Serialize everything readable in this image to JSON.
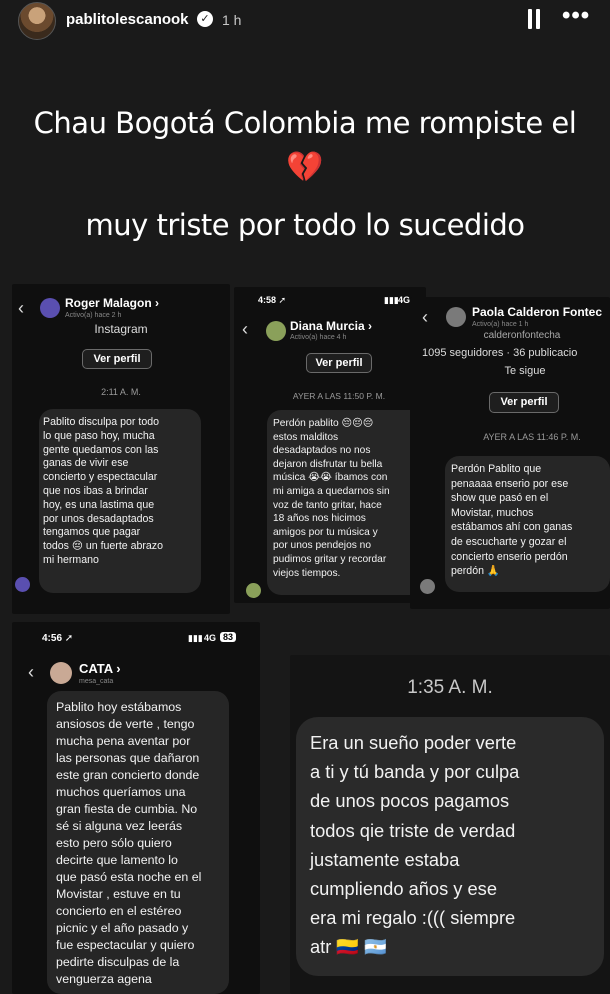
{
  "story": {
    "username": "pablitolescanook",
    "time": "1 h",
    "caption_line1": "Chau Bogotá Colombia me rompiste el",
    "caption_emoji": "💔",
    "caption_line2": "muy triste por todo lo sucedido"
  },
  "shots": {
    "roger": {
      "name": "Roger Malagon ›",
      "active": "Activo(a) hace 2 h",
      "platform": "Instagram",
      "profile_button": "Ver perfil",
      "timestamp": "2:11 A. M.",
      "message": "Pablito disculpa por todo\nlo que paso hoy, mucha\ngente quedamos con las\nganas de vivir ese\nconcierto y espectacular\nque nos ibas a brindar\nhoy, es una lastima que\npor unos desadaptados\ntengamos que pagar\ntodos 😔 un fuerte abrazo\nmi hermano"
    },
    "diana": {
      "clock": "4:58 ➚",
      "network": "4G",
      "name": "Diana Murcia ›",
      "active": "Activo(a) hace 4 h",
      "profile_button": "Ver perfil",
      "timestamp": "AYER A LAS 11:50 P. M.",
      "message": "Perdón pablito 😔😔😔\nestos malditos\ndesadaptados no nos\ndejaron disfrutar tu bella\nmúsica 😭😭 íbamos con\nmi amiga a quedarnos sin\nvoz de tanto gritar, hace\n18 años nos hicimos\namigos por tu música y\npor unos pendejos no\npudimos gritar y recordar\nviejos tiempos."
    },
    "paola": {
      "name": "Paola Calderon Fontec",
      "active": "Activo(a) hace 1 h",
      "handle": "calderonfontecha",
      "stats": "1095 seguidores · 36 publicacio",
      "follow_status": "Te sigue",
      "profile_button": "Ver perfil",
      "timestamp": "AYER A LAS 11:46 P. M.",
      "message": "Perdón Pablito que\npenaaaa enserio por ese\nshow que pasó en el\nMovistar, muchos\nestábamos ahí con ganas\nde escucharte y gozar el\nconcierto enserio perdón\nperdón 🙏"
    },
    "cata": {
      "clock": "4:56 ➚",
      "network": "4G",
      "battery": "83",
      "name": "CATA ›",
      "handle": "mesa_cata",
      "message": "Pablito hoy estábamos\nansiosos de verte , tengo\nmucha pena aventar por\nlas personas que dañaron\neste gran concierto donde\nmuchos queríamos una\ngran fiesta de cumbia. No\nsé si alguna vez leerás\nesto pero sólo quiero\ndecirte que lamento lo\nque pasó esta noche en el\nMovistar , estuve en tu\nconcierto en el estéreo\npicnic y el año pasado y\nfue espectacular y quiero\npedirte disculpas de la\nvenguerza agena"
    },
    "anon": {
      "timestamp": "1:35 A. M.",
      "message": "Era un sueño poder verte\na ti y tú banda y por culpa\nde unos pocos pagamos\ntodos qie triste de verdad\njustamente estaba\ncumpliendo años y ese\nera mi regalo :((( siempre\natr 🇨🇴 🇦🇷"
    }
  },
  "colors": {
    "background": "#1a1a1a",
    "bubble": "#262626",
    "broken_heart": "#e0202c"
  }
}
